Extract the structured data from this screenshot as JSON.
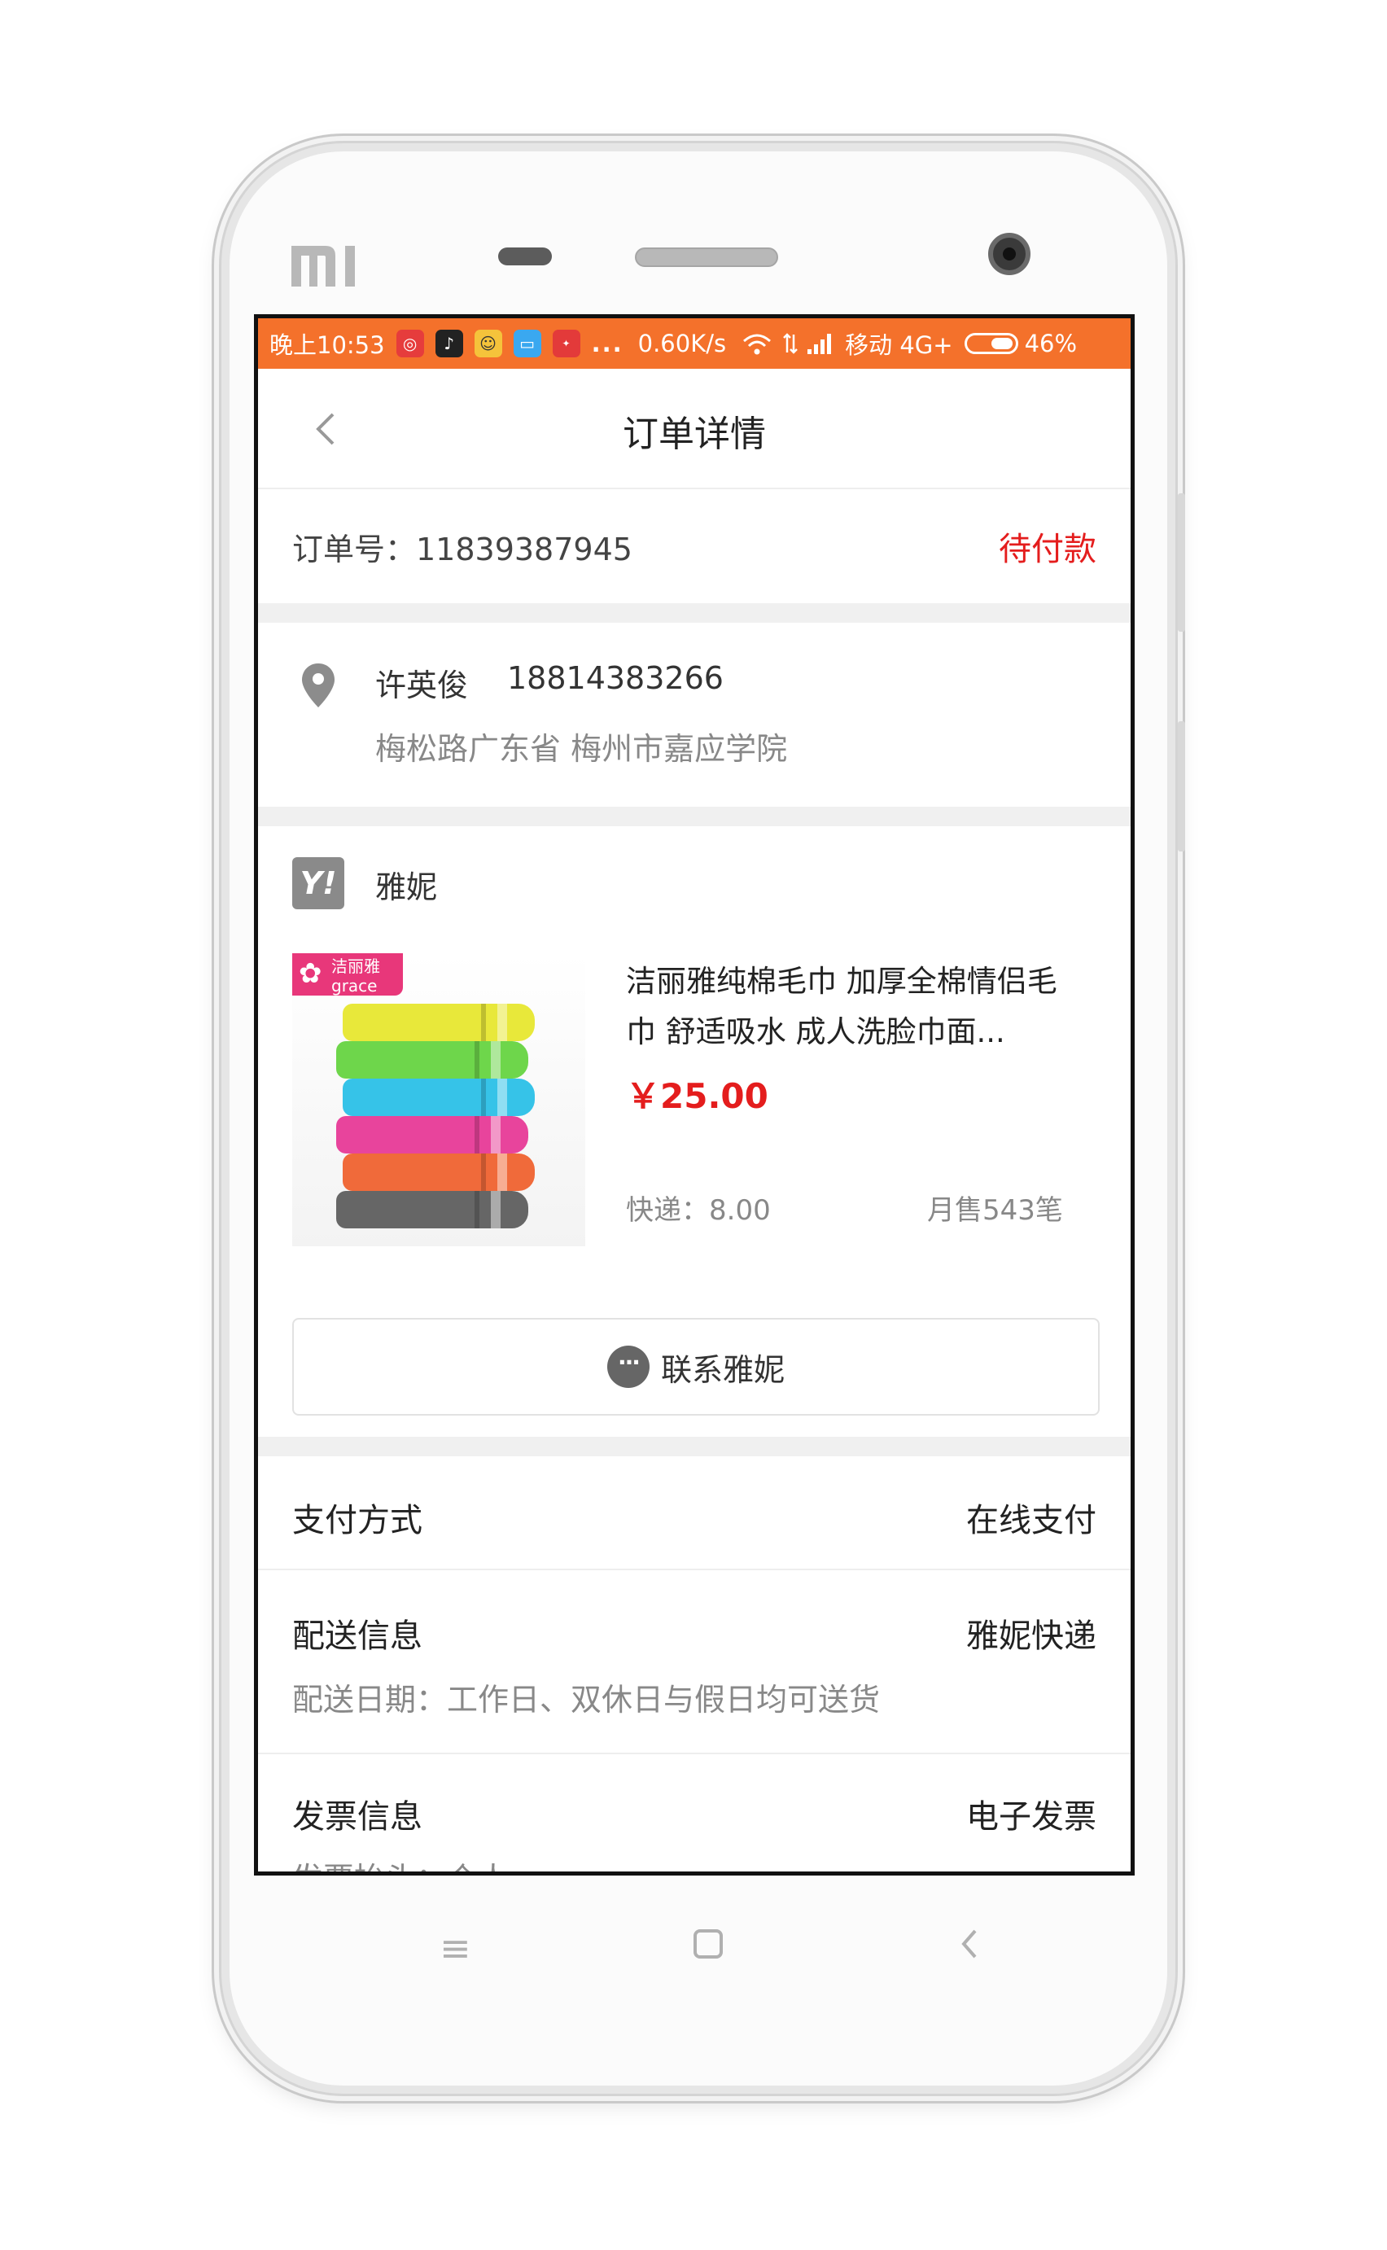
{
  "status_bar": {
    "time": "晚上10:53",
    "more": "...",
    "net_speed": "0.60K/s",
    "carrier": "移动 4G+",
    "battery": "46%",
    "app_icons": [
      "netease-music-icon",
      "tiktok-icon",
      "qq-icon",
      "message-icon",
      "zcom-icon"
    ]
  },
  "header": {
    "title": "订单详情"
  },
  "order": {
    "number_text": "订单号：11839387945",
    "status": "待付款"
  },
  "address": {
    "name": "许英俊",
    "phone": "18814383266",
    "detail": "梅松路广东省 梅州市嘉应学院"
  },
  "shop": {
    "logo_text": "Y!",
    "name": "雅妮"
  },
  "product": {
    "brand_tag_line1": "洁丽雅",
    "brand_tag_line2": "grace",
    "title": "洁丽雅纯棉毛巾 加厚全棉情侣毛巾 舒适吸水 成人洗脸巾面...",
    "price": "￥25.00",
    "shipping": "快递：8.00",
    "monthly_sales": "月售543笔",
    "towel_colors": [
      "#e8e83a",
      "#6ed64b",
      "#36c3e8",
      "#e8449c",
      "#f06a3a",
      "#666666"
    ]
  },
  "contact_button": {
    "label": "联系雅妮"
  },
  "payment": {
    "label": "支付方式",
    "value": "在线支付"
  },
  "delivery": {
    "label": "配送信息",
    "value": "雅妮快递",
    "sub": "配送日期：工作日、双休日与假日均可送货"
  },
  "invoice": {
    "label": "发票信息",
    "value": "电子发票",
    "sub": "发票抬头：个人"
  },
  "theme": {
    "accent": "#f4712b",
    "price_red": "#e41d1d"
  }
}
